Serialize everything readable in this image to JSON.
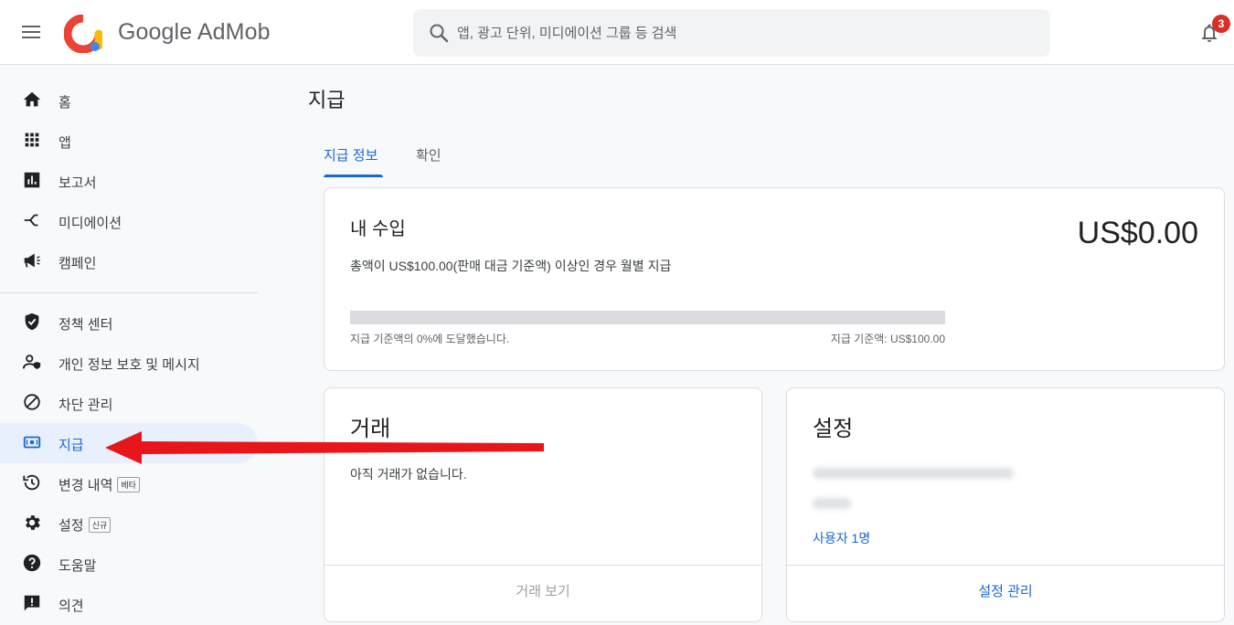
{
  "header": {
    "brand": "Google AdMob",
    "search_placeholder": "앱, 광고 단위, 미디에이션 그룹 등 검색",
    "notification_count": "3"
  },
  "sidebar": {
    "items": [
      {
        "label": "홈",
        "icon": "home-icon"
      },
      {
        "label": "앱",
        "icon": "apps-grid-icon"
      },
      {
        "label": "보고서",
        "icon": "bar-chart-icon"
      },
      {
        "label": "미디에이션",
        "icon": "mediation-icon"
      },
      {
        "label": "캠페인",
        "icon": "megaphone-icon"
      },
      {
        "label": "정책 센터",
        "icon": "shield-check-icon"
      },
      {
        "label": "개인 정보 보호 및 메시지",
        "icon": "privacy-user-icon"
      },
      {
        "label": "차단 관리",
        "icon": "block-icon"
      },
      {
        "label": "지급",
        "icon": "payments-icon"
      },
      {
        "label": "변경 내역",
        "icon": "history-icon",
        "tag": "베타"
      },
      {
        "label": "설정",
        "icon": "settings-gear-icon",
        "tag": "신규"
      },
      {
        "label": "도움말",
        "icon": "help-icon"
      },
      {
        "label": "의견",
        "icon": "feedback-icon"
      }
    ]
  },
  "main": {
    "title": "지급",
    "tabs": [
      {
        "label": "지급 정보",
        "active": true
      },
      {
        "label": "확인",
        "active": false
      }
    ],
    "earnings": {
      "title": "내 수입",
      "amount": "US$0.00",
      "description": "총액이 US$100.00(판매 대금 기준액) 이상인 경우 월별 지급",
      "progress_percent": 0,
      "progress_left": "지급 기준액의 0%에 도달했습니다.",
      "progress_right": "지급 기준액: US$100.00"
    },
    "transactions": {
      "title": "거래",
      "empty_text": "아직 거래가 없습니다.",
      "footer": "거래 보기"
    },
    "settings": {
      "title": "설정",
      "users_link": "사용자 1명",
      "footer": "설정 관리"
    }
  },
  "colors": {
    "accent": "#1967d2",
    "active_nav_bg": "#e8f0fe",
    "annotation_arrow": "#e8151b"
  }
}
